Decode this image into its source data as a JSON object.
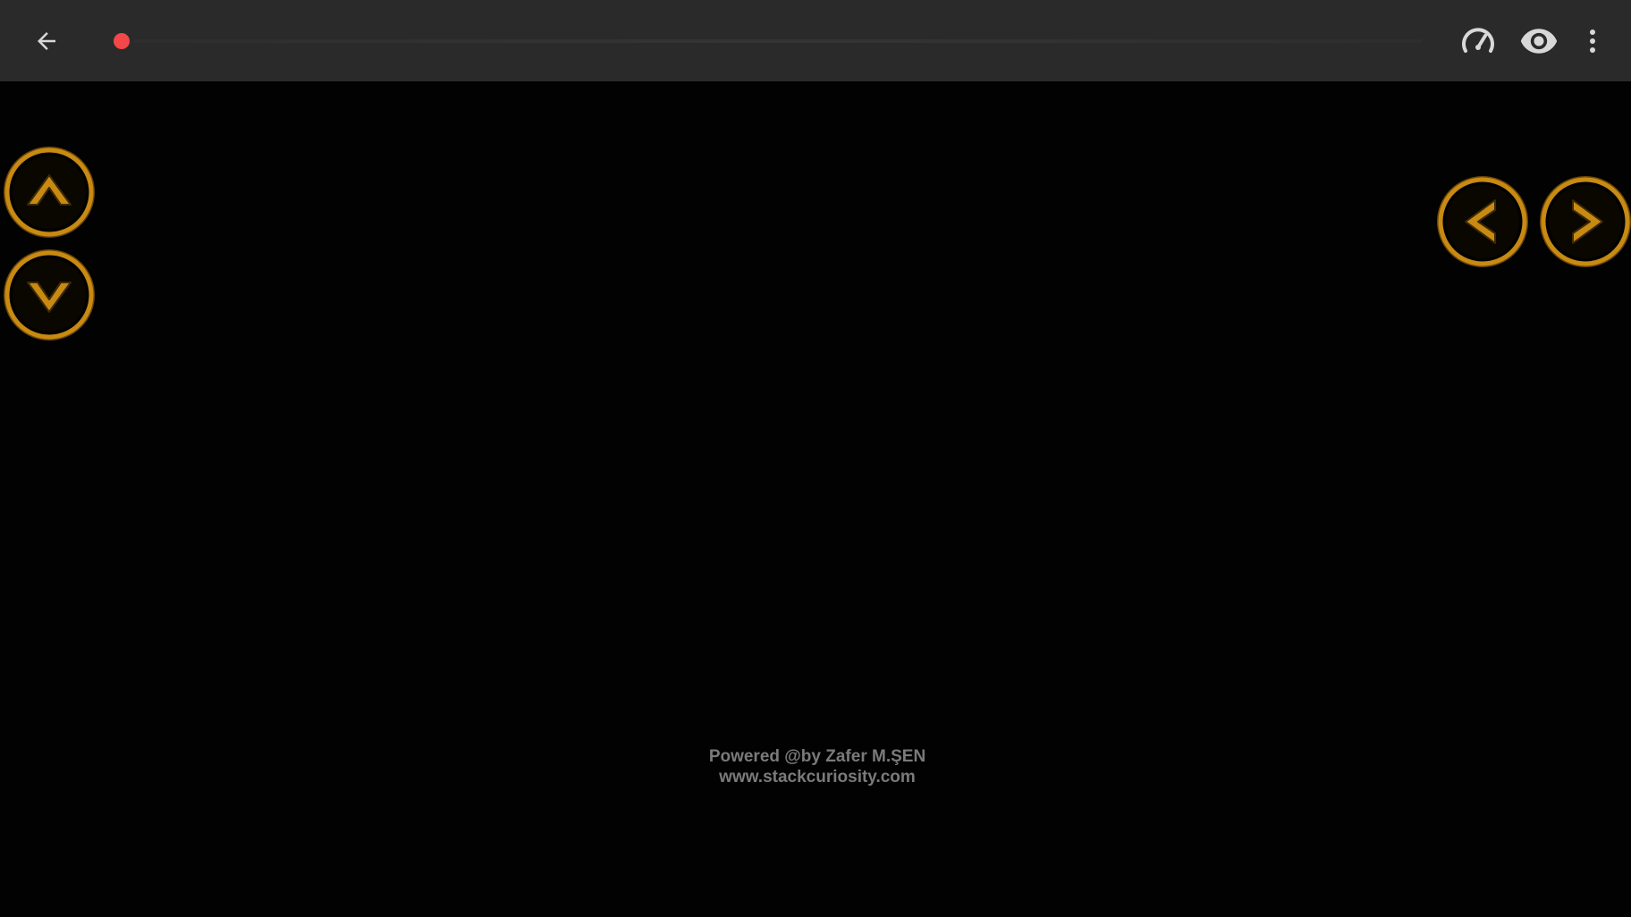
{
  "toolbar": {
    "back_icon": "arrow-left-icon",
    "record_indicator_color": "#f44747",
    "speed_icon": "speedometer-icon",
    "visibility_icon": "eye-icon",
    "more_icon": "more-vertical-icon",
    "icon_color": "#d8d8d8",
    "background": "#2a2a2b"
  },
  "game": {
    "background": "#020202",
    "button_color": "#c98a12",
    "controls": [
      {
        "id": "up",
        "icon": "arrow-up-icon"
      },
      {
        "id": "down",
        "icon": "arrow-down-icon"
      },
      {
        "id": "left",
        "icon": "arrow-left-icon"
      },
      {
        "id": "right",
        "icon": "arrow-right-icon"
      }
    ],
    "credits": {
      "line1": "Powered @by Zafer M.ŞEN",
      "line2": "www.stackcuriosity.com"
    }
  }
}
